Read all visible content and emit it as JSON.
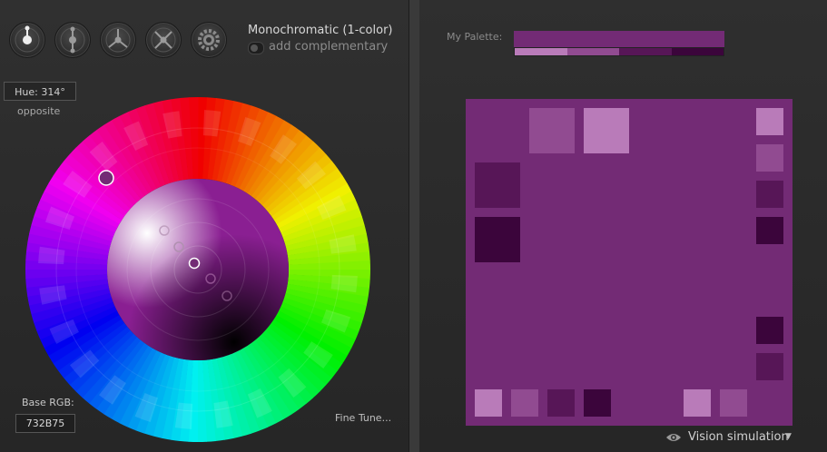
{
  "modes": [
    {
      "name": "mono-mode-button"
    },
    {
      "name": "complement-mode-button"
    },
    {
      "name": "triad-mode-button"
    },
    {
      "name": "tetrad-mode-button"
    },
    {
      "name": "analogic-mode-button"
    }
  ],
  "scheme": {
    "title": "Monochromatic (1-color)",
    "add_complementary": "add complementary"
  },
  "hue": {
    "label": "Hue: 314°",
    "opposite": "opposite"
  },
  "base": {
    "label": "Base RGB:",
    "value": "732B75"
  },
  "fine_tune": "Fine Tune...",
  "palette": {
    "label": "My Palette:",
    "main": "#732B75",
    "shades": [
      "#B97BB9",
      "#914B91",
      "#571657",
      "#3B053B"
    ]
  },
  "preview": {
    "background": "#732B75"
  },
  "vision": {
    "label": "Vision simulation",
    "arrow": "▼"
  },
  "icons": [
    "mono-icon",
    "complement-icon",
    "triad-icon",
    "tetrad-icon",
    "gear-icon",
    "eye-icon",
    "chevron-down-icon"
  ]
}
